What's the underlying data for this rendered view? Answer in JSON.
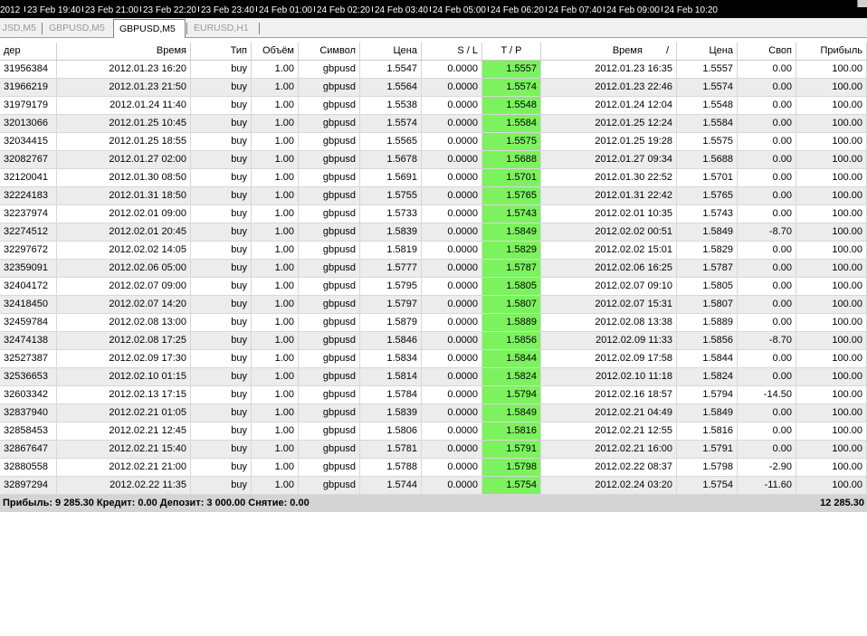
{
  "timeline": {
    "labels": [
      "2012",
      "23 Feb 19:40",
      "23 Feb 21:00",
      "23 Feb 22:20",
      "23 Feb 23:40",
      "24 Feb 01:00",
      "24 Feb 02:20",
      "24 Feb 03:40",
      "24 Feb 05:00",
      "24 Feb 06:20",
      "24 Feb 07:40",
      "24 Feb 09:00",
      "24 Feb 10:20"
    ]
  },
  "tabs": [
    {
      "label": "JSD,M5",
      "active": false
    },
    {
      "label": "GBPUSD,M5",
      "active": false
    },
    {
      "label": "GBPUSD,M5",
      "active": true
    },
    {
      "label": "EURUSD,H1",
      "active": false
    }
  ],
  "table": {
    "columns": [
      "дер",
      "Время",
      "Тип",
      "Объём",
      "Символ",
      "Цена",
      "S / L",
      "T / P",
      "Время",
      "Цена",
      "Своп",
      "Прибыль"
    ],
    "sort_indicator": "/",
    "rows": [
      [
        "31956384",
        "2012.01.23 16:20",
        "buy",
        "1.00",
        "gbpusd",
        "1.5547",
        "0.0000",
        "1.5557",
        "2012.01.23 16:35",
        "1.5557",
        "0.00",
        "100.00"
      ],
      [
        "31966219",
        "2012.01.23 21:50",
        "buy",
        "1.00",
        "gbpusd",
        "1.5564",
        "0.0000",
        "1.5574",
        "2012.01.23 22:46",
        "1.5574",
        "0.00",
        "100.00"
      ],
      [
        "31979179",
        "2012.01.24 11:40",
        "buy",
        "1.00",
        "gbpusd",
        "1.5538",
        "0.0000",
        "1.5548",
        "2012.01.24 12:04",
        "1.5548",
        "0.00",
        "100.00"
      ],
      [
        "32013066",
        "2012.01.25 10:45",
        "buy",
        "1.00",
        "gbpusd",
        "1.5574",
        "0.0000",
        "1.5584",
        "2012.01.25 12:24",
        "1.5584",
        "0.00",
        "100.00"
      ],
      [
        "32034415",
        "2012.01.25 18:55",
        "buy",
        "1.00",
        "gbpusd",
        "1.5565",
        "0.0000",
        "1.5575",
        "2012.01.25 19:28",
        "1.5575",
        "0.00",
        "100.00"
      ],
      [
        "32082767",
        "2012.01.27 02:00",
        "buy",
        "1.00",
        "gbpusd",
        "1.5678",
        "0.0000",
        "1.5688",
        "2012.01.27 09:34",
        "1.5688",
        "0.00",
        "100.00"
      ],
      [
        "32120041",
        "2012.01.30 08:50",
        "buy",
        "1.00",
        "gbpusd",
        "1.5691",
        "0.0000",
        "1.5701",
        "2012.01.30 22:52",
        "1.5701",
        "0.00",
        "100.00"
      ],
      [
        "32224183",
        "2012.01.31 18:50",
        "buy",
        "1.00",
        "gbpusd",
        "1.5755",
        "0.0000",
        "1.5765",
        "2012.01.31 22:42",
        "1.5765",
        "0.00",
        "100.00"
      ],
      [
        "32237974",
        "2012.02.01 09:00",
        "buy",
        "1.00",
        "gbpusd",
        "1.5733",
        "0.0000",
        "1.5743",
        "2012.02.01 10:35",
        "1.5743",
        "0.00",
        "100.00"
      ],
      [
        "32274512",
        "2012.02.01 20:45",
        "buy",
        "1.00",
        "gbpusd",
        "1.5839",
        "0.0000",
        "1.5849",
        "2012.02.02 00:51",
        "1.5849",
        "-8.70",
        "100.00"
      ],
      [
        "32297672",
        "2012.02.02 14:05",
        "buy",
        "1.00",
        "gbpusd",
        "1.5819",
        "0.0000",
        "1.5829",
        "2012.02.02 15:01",
        "1.5829",
        "0.00",
        "100.00"
      ],
      [
        "32359091",
        "2012.02.06 05:00",
        "buy",
        "1.00",
        "gbpusd",
        "1.5777",
        "0.0000",
        "1.5787",
        "2012.02.06 16:25",
        "1.5787",
        "0.00",
        "100.00"
      ],
      [
        "32404172",
        "2012.02.07 09:00",
        "buy",
        "1.00",
        "gbpusd",
        "1.5795",
        "0.0000",
        "1.5805",
        "2012.02.07 09:10",
        "1.5805",
        "0.00",
        "100.00"
      ],
      [
        "32418450",
        "2012.02.07 14:20",
        "buy",
        "1.00",
        "gbpusd",
        "1.5797",
        "0.0000",
        "1.5807",
        "2012.02.07 15:31",
        "1.5807",
        "0.00",
        "100.00"
      ],
      [
        "32459784",
        "2012.02.08 13:00",
        "buy",
        "1.00",
        "gbpusd",
        "1.5879",
        "0.0000",
        "1.5889",
        "2012.02.08 13:38",
        "1.5889",
        "0.00",
        "100.00"
      ],
      [
        "32474138",
        "2012.02.08 17:25",
        "buy",
        "1.00",
        "gbpusd",
        "1.5846",
        "0.0000",
        "1.5856",
        "2012.02.09 11:33",
        "1.5856",
        "-8.70",
        "100.00"
      ],
      [
        "32527387",
        "2012.02.09 17:30",
        "buy",
        "1.00",
        "gbpusd",
        "1.5834",
        "0.0000",
        "1.5844",
        "2012.02.09 17:58",
        "1.5844",
        "0.00",
        "100.00"
      ],
      [
        "32536653",
        "2012.02.10 01:15",
        "buy",
        "1.00",
        "gbpusd",
        "1.5814",
        "0.0000",
        "1.5824",
        "2012.02.10 11:18",
        "1.5824",
        "0.00",
        "100.00"
      ],
      [
        "32603342",
        "2012.02.13 17:15",
        "buy",
        "1.00",
        "gbpusd",
        "1.5784",
        "0.0000",
        "1.5794",
        "2012.02.16 18:57",
        "1.5794",
        "-14.50",
        "100.00"
      ],
      [
        "32837940",
        "2012.02.21 01:05",
        "buy",
        "1.00",
        "gbpusd",
        "1.5839",
        "0.0000",
        "1.5849",
        "2012.02.21 04:49",
        "1.5849",
        "0.00",
        "100.00"
      ],
      [
        "32858453",
        "2012.02.21 12:45",
        "buy",
        "1.00",
        "gbpusd",
        "1.5806",
        "0.0000",
        "1.5816",
        "2012.02.21 12:55",
        "1.5816",
        "0.00",
        "100.00"
      ],
      [
        "32867647",
        "2012.02.21 15:40",
        "buy",
        "1.00",
        "gbpusd",
        "1.5781",
        "0.0000",
        "1.5791",
        "2012.02.21 16:00",
        "1.5791",
        "0.00",
        "100.00"
      ],
      [
        "32880558",
        "2012.02.21 21:00",
        "buy",
        "1.00",
        "gbpusd",
        "1.5788",
        "0.0000",
        "1.5798",
        "2012.02.22 08:37",
        "1.5798",
        "-2.90",
        "100.00"
      ],
      [
        "32897294",
        "2012.02.22 11:35",
        "buy",
        "1.00",
        "gbpusd",
        "1.5744",
        "0.0000",
        "1.5754",
        "2012.02.24 03:20",
        "1.5754",
        "-11.60",
        "100.00"
      ]
    ]
  },
  "summary": {
    "text": "Прибыль: 9 285.30  Кредит: 0.00  Депозит: 3 000.00  Снятие: 0.00",
    "total": "12 285.30"
  },
  "colors": {
    "tp_highlight": "#7cf25e",
    "alt_row": "#ececec",
    "summary_bg": "#d4d4d4"
  }
}
